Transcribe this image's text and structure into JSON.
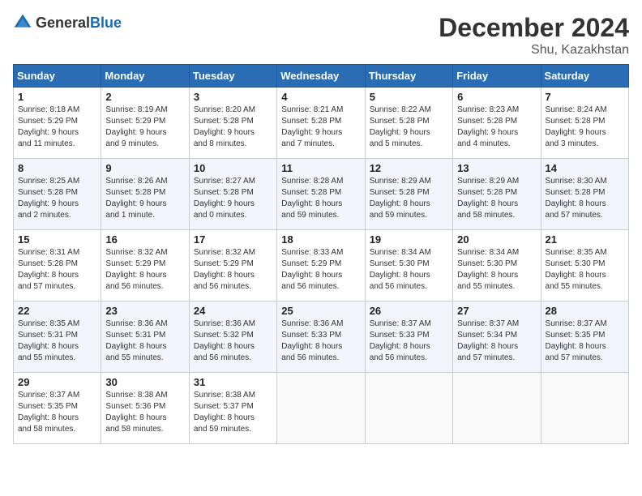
{
  "header": {
    "logo_general": "General",
    "logo_blue": "Blue",
    "month_title": "December 2024",
    "location": "Shu, Kazakhstan"
  },
  "days_of_week": [
    "Sunday",
    "Monday",
    "Tuesday",
    "Wednesday",
    "Thursday",
    "Friday",
    "Saturday"
  ],
  "weeks": [
    [
      {
        "day": "1",
        "lines": [
          "Sunrise: 8:18 AM",
          "Sunset: 5:29 PM",
          "Daylight: 9 hours",
          "and 11 minutes."
        ]
      },
      {
        "day": "2",
        "lines": [
          "Sunrise: 8:19 AM",
          "Sunset: 5:29 PM",
          "Daylight: 9 hours",
          "and 9 minutes."
        ]
      },
      {
        "day": "3",
        "lines": [
          "Sunrise: 8:20 AM",
          "Sunset: 5:28 PM",
          "Daylight: 9 hours",
          "and 8 minutes."
        ]
      },
      {
        "day": "4",
        "lines": [
          "Sunrise: 8:21 AM",
          "Sunset: 5:28 PM",
          "Daylight: 9 hours",
          "and 7 minutes."
        ]
      },
      {
        "day": "5",
        "lines": [
          "Sunrise: 8:22 AM",
          "Sunset: 5:28 PM",
          "Daylight: 9 hours",
          "and 5 minutes."
        ]
      },
      {
        "day": "6",
        "lines": [
          "Sunrise: 8:23 AM",
          "Sunset: 5:28 PM",
          "Daylight: 9 hours",
          "and 4 minutes."
        ]
      },
      {
        "day": "7",
        "lines": [
          "Sunrise: 8:24 AM",
          "Sunset: 5:28 PM",
          "Daylight: 9 hours",
          "and 3 minutes."
        ]
      }
    ],
    [
      {
        "day": "8",
        "lines": [
          "Sunrise: 8:25 AM",
          "Sunset: 5:28 PM",
          "Daylight: 9 hours",
          "and 2 minutes."
        ]
      },
      {
        "day": "9",
        "lines": [
          "Sunrise: 8:26 AM",
          "Sunset: 5:28 PM",
          "Daylight: 9 hours",
          "and 1 minute."
        ]
      },
      {
        "day": "10",
        "lines": [
          "Sunrise: 8:27 AM",
          "Sunset: 5:28 PM",
          "Daylight: 9 hours",
          "and 0 minutes."
        ]
      },
      {
        "day": "11",
        "lines": [
          "Sunrise: 8:28 AM",
          "Sunset: 5:28 PM",
          "Daylight: 8 hours",
          "and 59 minutes."
        ]
      },
      {
        "day": "12",
        "lines": [
          "Sunrise: 8:29 AM",
          "Sunset: 5:28 PM",
          "Daylight: 8 hours",
          "and 59 minutes."
        ]
      },
      {
        "day": "13",
        "lines": [
          "Sunrise: 8:29 AM",
          "Sunset: 5:28 PM",
          "Daylight: 8 hours",
          "and 58 minutes."
        ]
      },
      {
        "day": "14",
        "lines": [
          "Sunrise: 8:30 AM",
          "Sunset: 5:28 PM",
          "Daylight: 8 hours",
          "and 57 minutes."
        ]
      }
    ],
    [
      {
        "day": "15",
        "lines": [
          "Sunrise: 8:31 AM",
          "Sunset: 5:28 PM",
          "Daylight: 8 hours",
          "and 57 minutes."
        ]
      },
      {
        "day": "16",
        "lines": [
          "Sunrise: 8:32 AM",
          "Sunset: 5:29 PM",
          "Daylight: 8 hours",
          "and 56 minutes."
        ]
      },
      {
        "day": "17",
        "lines": [
          "Sunrise: 8:32 AM",
          "Sunset: 5:29 PM",
          "Daylight: 8 hours",
          "and 56 minutes."
        ]
      },
      {
        "day": "18",
        "lines": [
          "Sunrise: 8:33 AM",
          "Sunset: 5:29 PM",
          "Daylight: 8 hours",
          "and 56 minutes."
        ]
      },
      {
        "day": "19",
        "lines": [
          "Sunrise: 8:34 AM",
          "Sunset: 5:30 PM",
          "Daylight: 8 hours",
          "and 56 minutes."
        ]
      },
      {
        "day": "20",
        "lines": [
          "Sunrise: 8:34 AM",
          "Sunset: 5:30 PM",
          "Daylight: 8 hours",
          "and 55 minutes."
        ]
      },
      {
        "day": "21",
        "lines": [
          "Sunrise: 8:35 AM",
          "Sunset: 5:30 PM",
          "Daylight: 8 hours",
          "and 55 minutes."
        ]
      }
    ],
    [
      {
        "day": "22",
        "lines": [
          "Sunrise: 8:35 AM",
          "Sunset: 5:31 PM",
          "Daylight: 8 hours",
          "and 55 minutes."
        ]
      },
      {
        "day": "23",
        "lines": [
          "Sunrise: 8:36 AM",
          "Sunset: 5:31 PM",
          "Daylight: 8 hours",
          "and 55 minutes."
        ]
      },
      {
        "day": "24",
        "lines": [
          "Sunrise: 8:36 AM",
          "Sunset: 5:32 PM",
          "Daylight: 8 hours",
          "and 56 minutes."
        ]
      },
      {
        "day": "25",
        "lines": [
          "Sunrise: 8:36 AM",
          "Sunset: 5:33 PM",
          "Daylight: 8 hours",
          "and 56 minutes."
        ]
      },
      {
        "day": "26",
        "lines": [
          "Sunrise: 8:37 AM",
          "Sunset: 5:33 PM",
          "Daylight: 8 hours",
          "and 56 minutes."
        ]
      },
      {
        "day": "27",
        "lines": [
          "Sunrise: 8:37 AM",
          "Sunset: 5:34 PM",
          "Daylight: 8 hours",
          "and 57 minutes."
        ]
      },
      {
        "day": "28",
        "lines": [
          "Sunrise: 8:37 AM",
          "Sunset: 5:35 PM",
          "Daylight: 8 hours",
          "and 57 minutes."
        ]
      }
    ],
    [
      {
        "day": "29",
        "lines": [
          "Sunrise: 8:37 AM",
          "Sunset: 5:35 PM",
          "Daylight: 8 hours",
          "and 58 minutes."
        ]
      },
      {
        "day": "30",
        "lines": [
          "Sunrise: 8:38 AM",
          "Sunset: 5:36 PM",
          "Daylight: 8 hours",
          "and 58 minutes."
        ]
      },
      {
        "day": "31",
        "lines": [
          "Sunrise: 8:38 AM",
          "Sunset: 5:37 PM",
          "Daylight: 8 hours",
          "and 59 minutes."
        ]
      },
      null,
      null,
      null,
      null
    ]
  ]
}
